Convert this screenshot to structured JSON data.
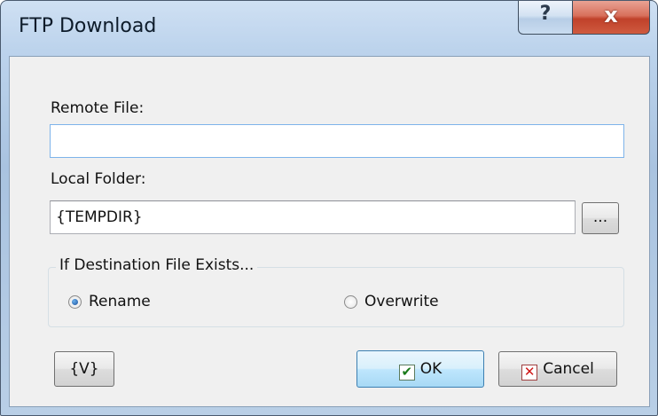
{
  "window": {
    "title": "FTP Download"
  },
  "caption_buttons": {
    "help_label": "?",
    "close_label": "x"
  },
  "remote_file": {
    "label": "Remote File:",
    "value": ""
  },
  "local_folder": {
    "label": "Local Folder:",
    "value": "{TEMPDIR}",
    "browse_label": "..."
  },
  "destination_group": {
    "legend": "If Destination File Exists...",
    "options": [
      {
        "label": "Rename",
        "selected": true
      },
      {
        "label": "Overwrite",
        "selected": false
      }
    ]
  },
  "buttons": {
    "variables_label": "{V}",
    "ok_label": "OK",
    "ok_icon": "checkmark-icon",
    "cancel_label": "Cancel",
    "cancel_icon": "x-mark-icon"
  },
  "colors": {
    "ok_check": "#1a7a1a",
    "cancel_x": "#d01818",
    "close_button": "#c0412a"
  }
}
